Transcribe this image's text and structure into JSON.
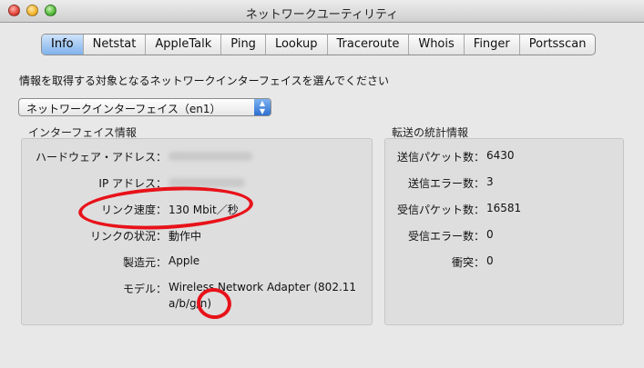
{
  "window": {
    "title": "ネットワークユーティリティ"
  },
  "tabs": [
    "Info",
    "Netstat",
    "AppleTalk",
    "Ping",
    "Lookup",
    "Traceroute",
    "Whois",
    "Finger",
    "Portsscan"
  ],
  "prompt": "情報を取得する対象となるネットワークインターフェイスを選んでください",
  "interface_select": {
    "selected": "ネットワークインターフェイス（en1）"
  },
  "interface_info": {
    "title": "インターフェイス情報",
    "hardware_address_label": "ハードウェア・アドレス：",
    "ip_address_label": "IP アドレス：",
    "link_speed_label": "リンク速度：",
    "link_speed_value": "130 Mbit／秒",
    "link_status_label": "リンクの状況：",
    "link_status_value": "動作中",
    "vendor_label": "製造元：",
    "vendor_value": "Apple",
    "model_label": "モデル：",
    "model_value_line1": "Wireless Network Adapter (802.11",
    "model_value_line2": "a/b/g/n)"
  },
  "transfer_stats": {
    "title": "転送の統計情報",
    "sent_packets_label": "送信パケット数：",
    "sent_packets_value": "6430",
    "send_errors_label": "送信エラー数：",
    "send_errors_value": "3",
    "received_packets_label": "受信パケット数：",
    "received_packets_value": "16581",
    "receive_errors_label": "受信エラー数：",
    "receive_errors_value": "0",
    "collisions_label": "衝突：",
    "collisions_value": "0"
  },
  "colors": {
    "accent": "#3b7fd9",
    "annotation": "#e8121a",
    "window_bg": "#e8e8e8"
  }
}
